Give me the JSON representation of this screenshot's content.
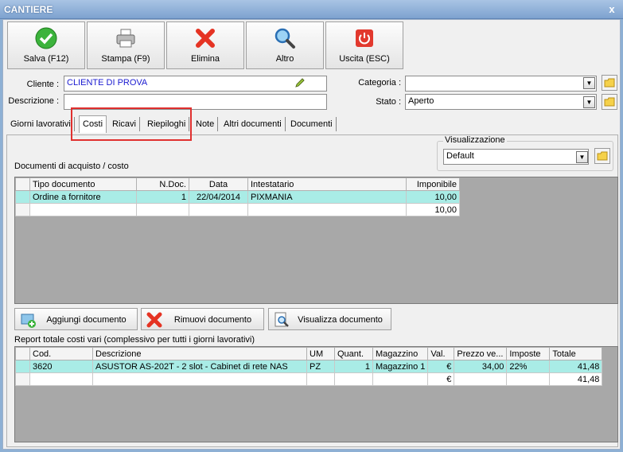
{
  "window": {
    "title": "CANTIERE",
    "close_glyph": "x"
  },
  "toolbar": [
    {
      "label": "Salva (F12)",
      "icon": "check-icon"
    },
    {
      "label": "Stampa (F9)",
      "icon": "printer-icon"
    },
    {
      "label": "Elimina",
      "icon": "delete-icon"
    },
    {
      "label": "Altro",
      "icon": "search-icon"
    },
    {
      "label": "Uscita (ESC)",
      "icon": "power-icon"
    }
  ],
  "form": {
    "cliente_label": "Cliente :",
    "cliente_value": "CLIENTE DI PROVA",
    "descrizione_label": "Descrizione :",
    "descrizione_value": "",
    "categoria_label": "Categoria :",
    "categoria_value": "",
    "stato_label": "Stato :",
    "stato_value": "Aperto"
  },
  "tabs": [
    {
      "label": "Giorni lavorativi",
      "active": false
    },
    {
      "label": "Costi",
      "active": true
    },
    {
      "label": "Ricavi",
      "active": false
    },
    {
      "label": "Riepiloghi",
      "active": false
    },
    {
      "label": "Note",
      "active": false
    },
    {
      "label": "Altri documenti",
      "active": false
    },
    {
      "label": "Documenti",
      "active": false
    }
  ],
  "visualizzazione": {
    "label": "Visualizzazione",
    "value": "Default"
  },
  "documents": {
    "section_label": "Documenti di acquisto / costo",
    "columns": [
      "Tipo documento",
      "N.Doc.",
      "Data",
      "Intestatario",
      "Imponibile"
    ],
    "rows": [
      [
        "Ordine a fornitore",
        "1",
        "22/04/2014",
        "PIXMANIA",
        "10,00"
      ]
    ],
    "total": "10,00"
  },
  "actions": [
    {
      "label": "Aggiungi documento",
      "icon": "add-document-icon"
    },
    {
      "label": "Rimuovi documento",
      "icon": "remove-icon"
    },
    {
      "label": "Visualizza documento",
      "icon": "view-document-icon"
    }
  ],
  "report": {
    "section_label": "Report totale costi vari (complessivo per tutti i giorni lavorativi)",
    "columns": [
      "Cod.",
      "Descrizione",
      "UM",
      "Quant.",
      "Magazzino",
      "Val.",
      "Prezzo ve...",
      "Imposte",
      "Totale"
    ],
    "rows": [
      [
        "3620",
        "ASUSTOR AS-202T - 2 slot - Cabinet di rete NAS",
        "PZ",
        "1",
        "Magazzino 1",
        "€",
        "34,00",
        "22%",
        "41,48"
      ]
    ],
    "total_currency": "€",
    "total": "41,48"
  },
  "colors": {
    "selected_row": "#a9ece6",
    "highlight_box": "#e0302f",
    "link_text": "#1a1ad0"
  }
}
